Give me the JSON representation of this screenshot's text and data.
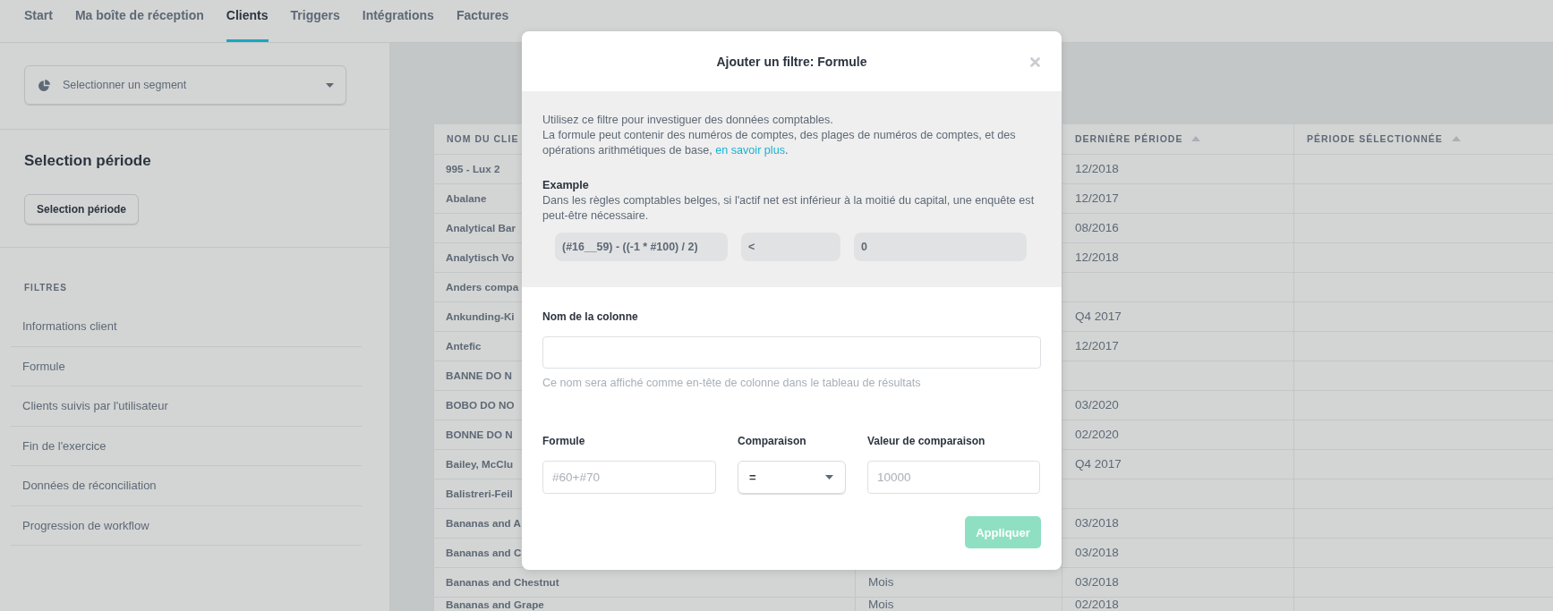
{
  "tabs": [
    {
      "label": "Start",
      "selected": false
    },
    {
      "label": "Ma boîte de réception",
      "selected": false
    },
    {
      "label": "Clients",
      "selected": true
    },
    {
      "label": "Triggers",
      "selected": false
    },
    {
      "label": "Intégrations",
      "selected": false
    },
    {
      "label": "Factures",
      "selected": false
    }
  ],
  "sidebar": {
    "segment_select": {
      "placeholder": "Selectionner un segment"
    },
    "period": {
      "title": "Selection période",
      "button": "Selection période"
    },
    "filters": {
      "title": "FILTRES",
      "items": [
        "Informations client",
        "Formule",
        "Clients suivis par l'utilisateur",
        "Fin de l'exercice",
        "Données de réconciliation",
        "Progression de workflow"
      ]
    }
  },
  "table": {
    "columns": [
      {
        "label": "NOM DU CLIE"
      },
      {},
      {
        "label": "DERNIÈRE PÉRIODE",
        "sortable": true
      },
      {
        "label": "PÉRIODE SÉLECTIONNÉE",
        "sortable": true
      }
    ],
    "rows": [
      {
        "cells": [
          "995 - Lux 2",
          null,
          "12/2018"
        ]
      },
      {
        "cells": [
          "Abalane",
          null,
          "12/2017"
        ]
      },
      {
        "cells": [
          "Analytical Bar",
          null,
          "08/2016"
        ]
      },
      {
        "cells": [
          "Analytisch Vo",
          null,
          "12/2018"
        ]
      },
      {
        "cells": [
          "Anders compa",
          null,
          null
        ]
      },
      {
        "cells": [
          "Ankunding-Ki",
          null,
          "Q4 2017"
        ]
      },
      {
        "cells": [
          "Antefic",
          null,
          "12/2017"
        ]
      },
      {
        "cells": [
          "BANNE DO N",
          null,
          null
        ]
      },
      {
        "cells": [
          "BOBO DO NO",
          null,
          "03/2020"
        ]
      },
      {
        "cells": [
          "BONNE DO N",
          null,
          "02/2020"
        ]
      },
      {
        "cells": [
          "Bailey, McClu",
          null,
          "Q4 2017"
        ]
      },
      {
        "cells": [
          "Balistreri-Feil",
          null,
          null
        ]
      },
      {
        "cells": [
          "Bananas and A",
          null,
          "03/2018"
        ]
      },
      {
        "cells": [
          "Bananas and C",
          null,
          "03/2018"
        ]
      },
      {
        "cells": [
          "Bananas and Chestnut",
          "Mois",
          "03/2018"
        ]
      },
      {
        "cells": [
          "Bananas and Grape",
          "Mois",
          "02/2018"
        ]
      }
    ]
  },
  "modal": {
    "title": "Ajouter un filtre: Formule",
    "info": {
      "lines": [
        "Utilisez ce filtre pour investiguer des données comptables.",
        "La formule peut contenir des numéros de comptes, des plages de numéros de comptes, et des opérations arithmétiques de base,"
      ],
      "link": "en savoir plus",
      "link_suffix": "."
    },
    "example": {
      "title": "Example",
      "text": "Dans les règles comptables belges, si l'actif net est inférieur à la moitié du capital, une enquête est peut-être nécessaire.",
      "formula": "(#16__59) - ((-1 * #100) / 2)",
      "operator": "<",
      "value": "0"
    },
    "column_name": {
      "label": "Nom de la colonne",
      "hint": "Ce nom sera affiché comme en-tête de colonne dans le tableau de résultats"
    },
    "formula": {
      "label": "Formule",
      "placeholder": "#60+#70"
    },
    "comparison": {
      "label": "Comparaison",
      "value": "="
    },
    "comparison_value": {
      "label": "Valeur de comparaison",
      "placeholder": "10000"
    },
    "apply_button": {
      "label": "Appliquer",
      "disabled": true
    }
  }
}
